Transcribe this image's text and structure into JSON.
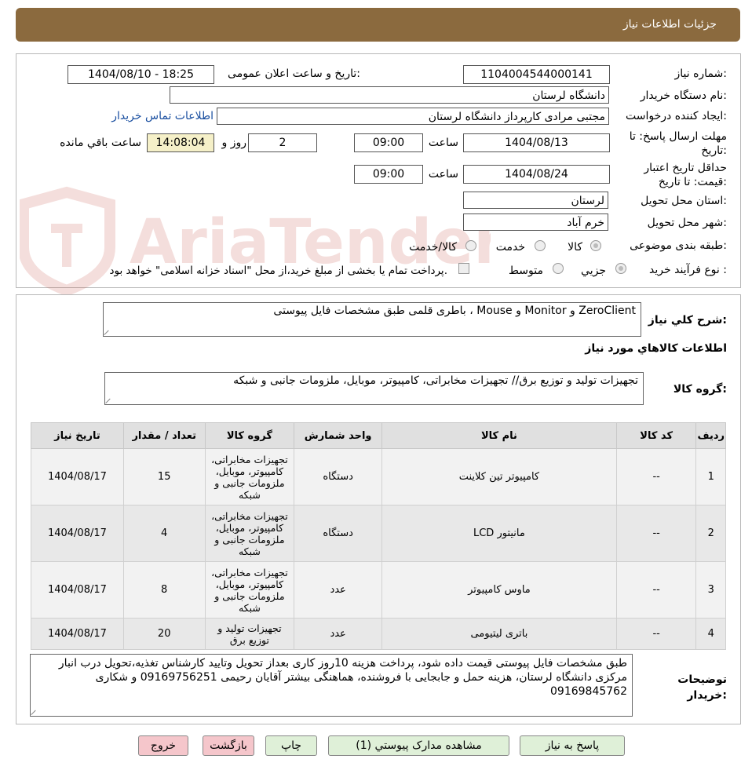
{
  "header": {
    "title": "جزئیات اطلاعات نیاز"
  },
  "watermark": {
    "text": "AriaTender.net",
    "color": "#c0392b"
  },
  "form": {
    "need_number_label": "شماره نیاز:",
    "need_number": "1104004544000141",
    "announce_label": "تاریخ و ساعت اعلان عمومی:",
    "announce_value": "1404/08/10 - 18:25",
    "buyer_org_label": "نام دستگاه خریدار:",
    "buyer_org": "دانشگاه لرستان",
    "creator_label": "ایجاد کننده درخواست:",
    "creator": "مجتبی مرادی کارپرداز دانشگاه لرستان",
    "contact_link": "اطلاعات تماس خریدار",
    "deadline_label": "مهلت ارسال پاسخ: تا تاریخ:",
    "deadline_date": "1404/08/13",
    "time_label": "ساعت",
    "deadline_time": "09:00",
    "days_value": "2",
    "days_label": "روز و",
    "remaining_time": "14:08:04",
    "remaining_label": "ساعت باقي مانده",
    "validity_label": "حداقل تاریخ اعتبار قیمت: تا تاریخ:",
    "validity_date": "1404/08/24",
    "validity_time": "09:00",
    "province_label": "استان محل تحویل:",
    "province": "لرستان",
    "city_label": "شهر محل تحویل:",
    "city": "خرم آباد",
    "category_label": "طبقه بندی موضوعی:",
    "category_options": [
      "کالا",
      "خدمت",
      "کالا/خدمت"
    ],
    "category_selected": "کالا",
    "process_label": "نوع فرآیند خرید :",
    "process_options": [
      "جزیي",
      "متوسط"
    ],
    "process_selected": "جزیي",
    "payment_note": "پرداخت تمام یا بخشی از مبلغ خرید،از محل \"اسناد خزانه اسلامی\" خواهد بود."
  },
  "description": {
    "label": "شرح کلي نياز:",
    "text": "ZeroClient و Monitor و Mouse ، باطری قلمی طبق مشخصات فایل پیوستی"
  },
  "goods_section": {
    "title": "اطلاعات کالاهاي مورد نياز",
    "group_label": "گروه کالا:",
    "group_text": "تجهیزات تولید و توزیع برق// تجهیزات مخابراتی، کامپیوتر، موبایل، ملزومات جانبی و شبکه"
  },
  "table": {
    "headers": [
      "رديف",
      "کد کالا",
      "نام کالا",
      "واحد شمارش",
      "گروه کالا",
      "تعداد / مقدار",
      "تاريخ نياز"
    ],
    "rows": [
      {
        "row": "1",
        "code": "--",
        "name": "کامپیوتر تین کلاینت",
        "unit": "دستگاه",
        "group": "تجهیزات مخابراتی، کامپیوتر، موبایل، ملزومات جانبی و شبکه",
        "qty": "15",
        "date": "1404/08/17"
      },
      {
        "row": "2",
        "code": "--",
        "name": "مانیتور LCD",
        "unit": "دستگاه",
        "group": "تجهیزات مخابراتی، کامپیوتر، موبایل، ملزومات جانبی و شبکه",
        "qty": "4",
        "date": "1404/08/17"
      },
      {
        "row": "3",
        "code": "--",
        "name": "ماوس کامپیوتر",
        "unit": "عدد",
        "group": "تجهیزات مخابراتی، کامپیوتر، موبایل، ملزومات جانبی و شبکه",
        "qty": "8",
        "date": "1404/08/17"
      },
      {
        "row": "4",
        "code": "--",
        "name": "باتری لیتیومی",
        "unit": "عدد",
        "group": "تجهیزات تولید و توزیع برق",
        "qty": "20",
        "date": "1404/08/17"
      }
    ]
  },
  "buyer_notes": {
    "label": "توضیحات خریدار:",
    "text": "طبق مشخصات فایل پیوستی قیمت داده شود، پرداخت هزینه 10روز کاری بعداز تحویل وتایید کارشناس تغذیه،تحویل درب انبار مرکزی دانشگاه لرستان، هزینه  حمل و جابجایی با فروشنده، هماهنگی بیشتر آقایان رحیمی 09169756251 و شکاری 09169845762"
  },
  "buttons": {
    "reply": "پاسخ به نیاز",
    "attachments": "مشاهده مدارک پیوستي (1)",
    "print": "چاپ",
    "back": "بازگشت",
    "exit": "خروج"
  }
}
